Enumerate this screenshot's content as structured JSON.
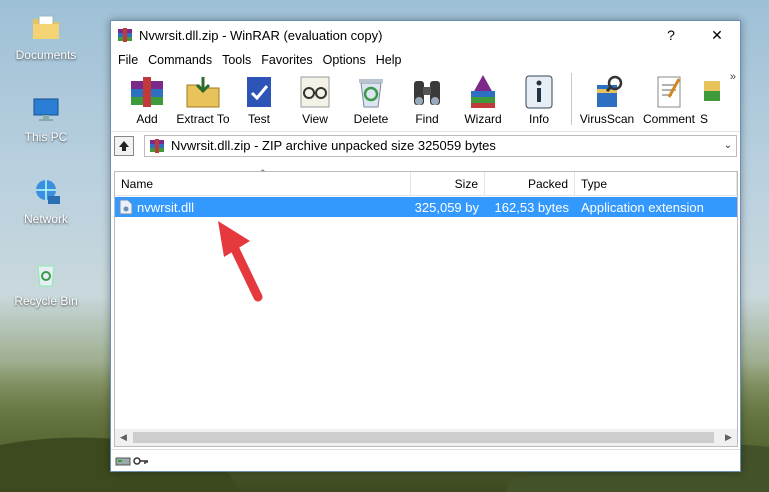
{
  "desktop": {
    "icons": [
      {
        "label": "Documents",
        "icon": "folder-documents-icon"
      },
      {
        "label": "This PC",
        "icon": "computer-icon"
      },
      {
        "label": "Network",
        "icon": "network-icon"
      },
      {
        "label": "Recycle Bin",
        "icon": "recycle-bin-icon"
      }
    ]
  },
  "window": {
    "title": "Nvwrsit.dll.zip - WinRAR (evaluation copy)",
    "help_button": "?",
    "close_button": "✕"
  },
  "menu": [
    "File",
    "Commands",
    "Tools",
    "Favorites",
    "Options",
    "Help"
  ],
  "toolbar": {
    "buttons": [
      {
        "label": "Add",
        "icon": "add-archive-icon"
      },
      {
        "label": "Extract To",
        "icon": "extract-folder-icon"
      },
      {
        "label": "Test",
        "icon": "test-clipboard-icon"
      },
      {
        "label": "View",
        "icon": "view-glasses-icon"
      },
      {
        "label": "Delete",
        "icon": "delete-recycle-icon"
      },
      {
        "label": "Find",
        "icon": "binoculars-icon"
      },
      {
        "label": "Wizard",
        "icon": "wizard-icon"
      },
      {
        "label": "Info",
        "icon": "info-icon"
      },
      {
        "label": "VirusScan",
        "icon": "virus-scan-icon"
      },
      {
        "label": "Comment",
        "icon": "comment-icon"
      },
      {
        "label": "S",
        "icon": "sfx-icon"
      }
    ],
    "more": "»"
  },
  "address": {
    "text": "Nvwrsit.dll.zip - ZIP archive unpacked size 325059 bytes"
  },
  "columns": [
    "Name",
    "Size",
    "Packed",
    "Type"
  ],
  "files": [
    {
      "name": "nvwrsit.dll",
      "size": "325,059 by",
      "packed": "162,53 bytes",
      "type": "Application extension",
      "selected": true
    }
  ],
  "colors": {
    "selection": "#3399ff",
    "annotation_arrow": "#e5393d"
  }
}
